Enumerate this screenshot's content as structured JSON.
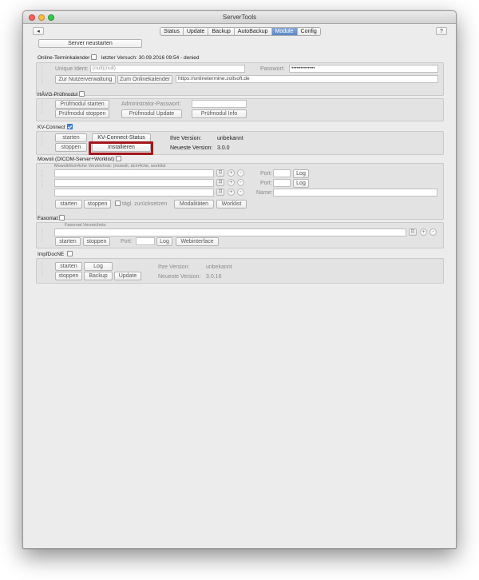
{
  "window": {
    "title": "ServerTools"
  },
  "toolbar": {
    "back_label": "◂",
    "help_label": "?",
    "tabs": [
      {
        "label": "Status"
      },
      {
        "label": "Update"
      },
      {
        "label": "Backup"
      },
      {
        "label": "AutoBackup"
      },
      {
        "label": "Module",
        "active": true
      },
      {
        "label": "Config"
      }
    ]
  },
  "server_restart_label": "Server neustarten",
  "online_termin": {
    "title": "Online-Terminkalender",
    "last_attempt": "letzter Versuch: 30.09.2016 09:54 - denied",
    "unique_ident_label": "Unique Ident:",
    "unique_ident_value": "(null)(null)",
    "password_label": "Passwort:",
    "password_value": "•••••••••••••",
    "btn_user_mgmt": "Zur Nutzerverwaltung",
    "btn_online_cal": "Zum Onlinekalender",
    "url": "https://onlinetermine.zollsoft.de"
  },
  "havg": {
    "title": "HÄVG-Prüfmodul",
    "btn_start": "Prüfmodul starten",
    "btn_stop": "Prüfmodul stoppen",
    "admin_pw_label": "Administrator-Passwort:",
    "btn_update": "Prüfmodul Update",
    "btn_info": "Prüfmodul Info"
  },
  "kv_connect": {
    "title": "KV-Connect",
    "btn_start": "starten",
    "btn_status": "KV-Connect-Status",
    "btn_stop": "stoppen",
    "btn_install": "Installieren",
    "your_version_label": "Ihre Version:",
    "your_version_value": "unbekannt",
    "latest_version_label": "Neueste Version:",
    "latest_version_value": "3.0.0"
  },
  "mowoli": {
    "title": "Mowoli (DICOM-Server+Worklist)",
    "dir_label": "Mowoli/dcm4che Verzeichnis: (mowoli, dcm4che, worklist",
    "port_label": "Port:",
    "name_label": "Name:",
    "log_label": "Log",
    "btn_start": "starten",
    "btn_stop": "stoppen",
    "daily_reset_label": "tägl. zurücksetzen",
    "btn_modalities": "Modalitäten",
    "btn_worklist": "Worklist"
  },
  "faxomat": {
    "title": "Faxomat",
    "dir_label": "Faxomat Verzeichnis:",
    "btn_start": "starten",
    "btn_stop": "stoppen",
    "port_label": "Port:",
    "log_label": "Log",
    "btn_web": "Webinterface"
  },
  "impfdocne": {
    "title": "ImpfDocNE",
    "btn_start": "starten",
    "btn_log": "Log",
    "btn_stop": "stoppen",
    "btn_backup": "Backup",
    "btn_update": "Update",
    "your_version_label": "Ihre Version:",
    "your_version_value": "unbekannt",
    "latest_version_label": "Neueste Version:",
    "latest_version_value": "3.0.16"
  },
  "colors": {
    "highlight": "#a3171b",
    "active_tab": "#5b86c7"
  }
}
